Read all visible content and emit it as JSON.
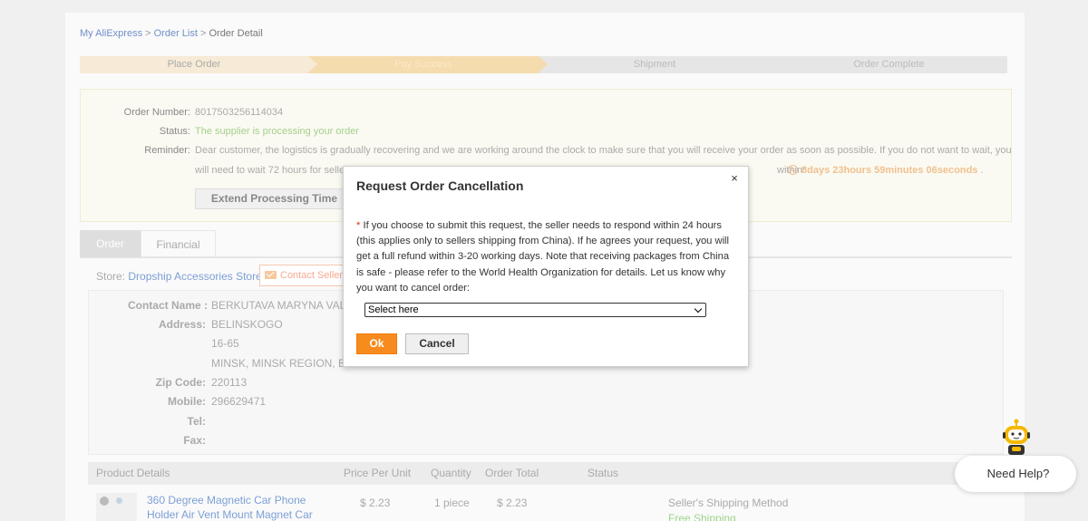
{
  "breadcrumb": {
    "home": "My AliExpress",
    "separator": " > ",
    "order_list": "Order List",
    "current": "Order Detail"
  },
  "steps": [
    "Place Order",
    "Pay Success",
    "Shipment",
    "Order Complete"
  ],
  "order_info": {
    "number_label": "Order Number:",
    "number_value": "8017503256114034",
    "status_label": "Status:",
    "status_value": "The supplier is processing your order",
    "reminder_label": "Reminder:",
    "reminder_line1": "Dear customer, the logistics is gradually recovering and we are working around the clock to make sure that you will receive your order as soon as possible. If you do not want to wait, you",
    "reminder_line2_start": "will need to wait 72 hours for seller",
    "reminder_line2_end": "within:",
    "countdown": "8days 23hours 59minutes 06seconds",
    "countdown_suffix": ".",
    "extend_button": "Extend Processing Time"
  },
  "tabs": [
    "Order",
    "Financial"
  ],
  "store": {
    "label": "Store:",
    "name": "Dropship Accessories Store",
    "contact_button": "Contact Seller"
  },
  "address": {
    "contact_name_label": "Contact Name :",
    "contact_name_value": "BERKUTAVA MARYNA VALI",
    "address_label": "Address:",
    "address_line1": "BELINSKOGO",
    "address_line2": "16-65",
    "address_line3": "MINSK, MINSK REGION, Be",
    "zip_label": "Zip Code:",
    "zip_value": "220113",
    "mobile_label": "Mobile:",
    "mobile_value": "296629471",
    "tel_label": "Tel:",
    "fax_label": "Fax:"
  },
  "product_table": {
    "headers": [
      "Product Details",
      "Price Per Unit",
      "Quantity",
      "Order Total",
      "Status"
    ],
    "row": {
      "title_line1": "360 Degree Magnetic Car Phone",
      "title_line2": "Holder Air Vent Mount Magnet Car",
      "price": "$ 2.23",
      "quantity": "1 piece",
      "total": "$ 2.23",
      "shipping_method_label": "Seller's Shipping Method",
      "shipping_value": "Free Shipping"
    }
  },
  "modal": {
    "title": "Request Order Cancellation",
    "close": "×",
    "required_mark": "*",
    "text": " If you choose to submit this request, the seller needs to respond within 24 hours (this applies only to sellers shipping from China). If he agrees your request, you will get a full refund within 3-20 working days. Note that receiving packages from China is safe - please refer to the World Health Organization for details. Let us know why you want to cancel order:",
    "select_value": "Select here",
    "ok_button": "Ok",
    "cancel_button": "Cancel"
  },
  "help": {
    "label": "Need Help?"
  },
  "colors": {
    "accent_orange": "#f78b1e",
    "link_blue": "#6f8fc9",
    "status_green": "#a3d08a",
    "required_red": "#e62e04"
  }
}
